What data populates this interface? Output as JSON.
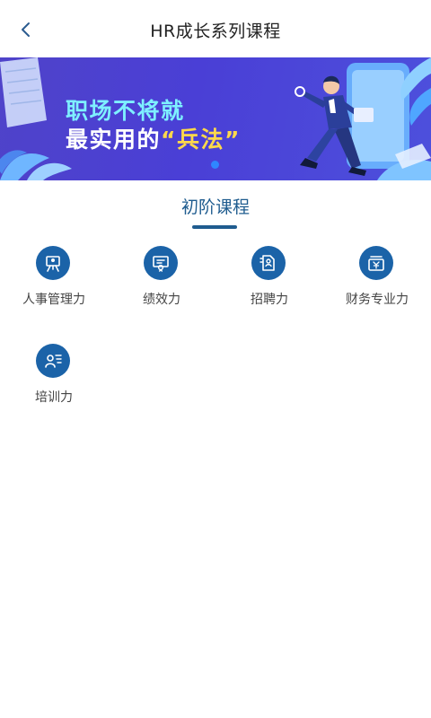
{
  "header": {
    "title": "HR成长系列课程",
    "back_icon": "chevron-left-icon"
  },
  "banner": {
    "line1": "职场不将就",
    "line2_prefix": "最实用的",
    "line2_highlight": "“兵法”",
    "colors": {
      "line1": "#7ef0ff",
      "line2": "#ffffff",
      "highlight": "#ffd94a",
      "background": "#4a3fd6"
    },
    "carousel_active_index": 1,
    "carousel_count": 1
  },
  "section": {
    "title": "初阶课程",
    "accent_color": "#1f5c8f"
  },
  "courses": [
    {
      "label": "人事管理力",
      "icon": "personnel-board-icon"
    },
    {
      "label": "绩效力",
      "icon": "certificate-icon"
    },
    {
      "label": "招聘力",
      "icon": "recruit-document-icon"
    },
    {
      "label": "财务专业力",
      "icon": "finance-icon"
    },
    {
      "label": "培训力",
      "icon": "trainer-icon"
    }
  ]
}
